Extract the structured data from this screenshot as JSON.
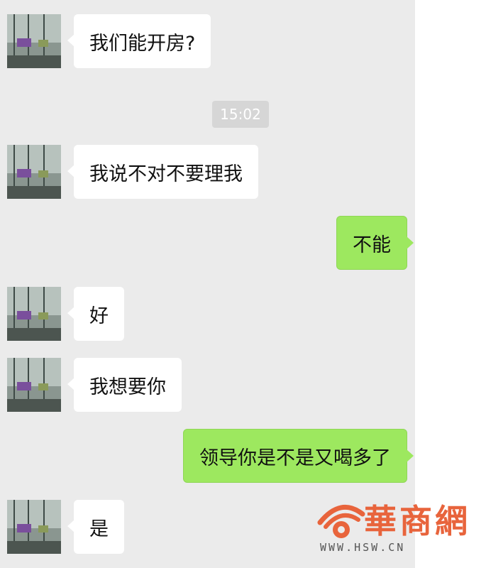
{
  "chat": {
    "timestamp": "15:02",
    "messages": [
      {
        "side": "in",
        "text": "我们能开房?"
      },
      {
        "side": "in",
        "text": "我说不对不要理我"
      },
      {
        "side": "out",
        "text": "不能"
      },
      {
        "side": "in",
        "text": "好"
      },
      {
        "side": "in",
        "text": "我想要你"
      },
      {
        "side": "out",
        "text": "领导你是不是又喝多了"
      },
      {
        "side": "in",
        "text": "是"
      }
    ]
  },
  "watermark": {
    "brand": "華商網",
    "url": "WWW.HSW.CN"
  },
  "colors": {
    "background": "#ebebeb",
    "incoming_bubble": "#ffffff",
    "outgoing_bubble": "#9de85f",
    "watermark": "#e8643c"
  }
}
